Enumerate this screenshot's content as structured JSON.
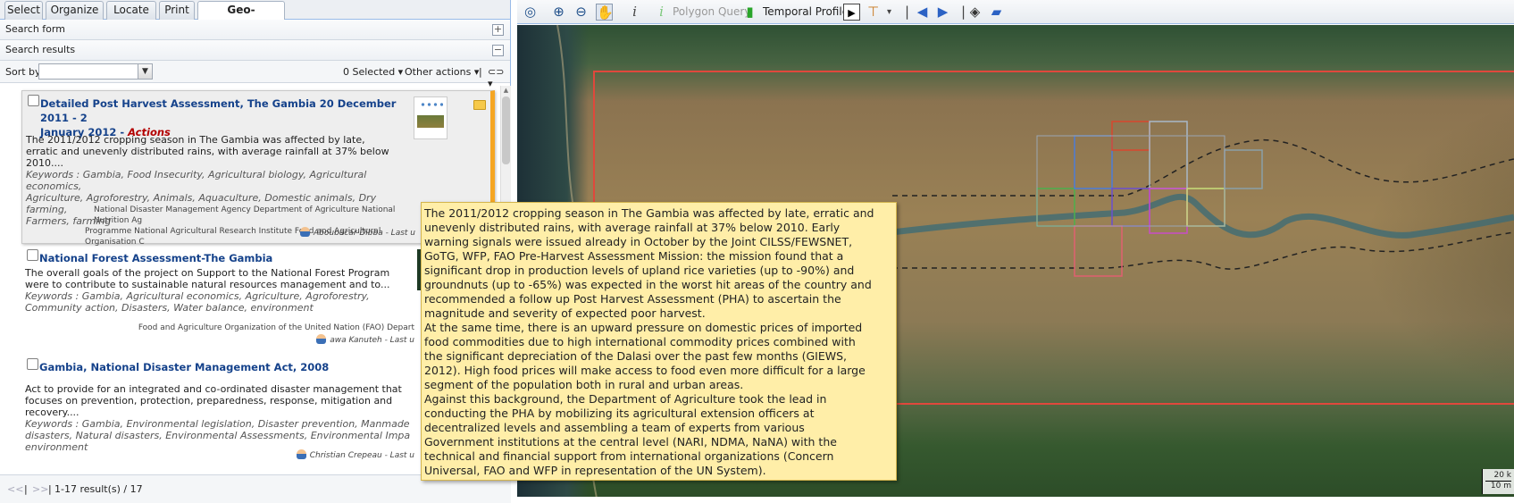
{
  "tabs": [
    "Select",
    "Organize",
    "Locate",
    "Print",
    "Geo-catalogue"
  ],
  "active_tab": "Geo-catalogue",
  "panels": {
    "search_form": "Search form",
    "search_form_toggle": "+",
    "search_results": "Search results",
    "search_results_toggle": "−"
  },
  "sortbar": {
    "sort_label": "Sort by",
    "sort_value": "",
    "selected": "0 Selected ▾",
    "other_actions": "Other actions ▾",
    "link_menu": "⊂⊃ ▾",
    "separator": "|"
  },
  "results": [
    {
      "title_line1": "Detailed Post Harvest Assessment, The Gambia 20 December 2011 - 2",
      "title_line2": "January 2012",
      "actions_label": "Actions",
      "abstract": [
        "The 2011/2012 cropping season in The Gambia was affected by late,",
        "erratic and unevenly distributed rains, with average rainfall at 37% below",
        "2010...."
      ],
      "keywords": [
        "Keywords : Gambia, Food Insecurity, Agricultural biology, Agricultural economics,",
        "Agriculture, Agroforestry, Animals, Aquaculture, Domestic animals, Dry farming,",
        "Farmers, farming"
      ],
      "orgs": [
        "National Disaster Management Agency   Department of Agriculture   National Nutrition Ag",
        "Programme   National Agricultural Research Institute   Food and Agricultural Organisation   C"
      ],
      "contact": "Aboubacar Dibba - Last u"
    },
    {
      "title_line1": "National Forest Assessment-The Gambia",
      "abstract": [
        "The overall goals of the project on Support to the National Forest Program",
        "were to contribute to sustainable natural resources management and to..."
      ],
      "keywords": [
        "Keywords : Gambia, Agricultural economics, Agriculture, Agroforestry,",
        "Community action, Disasters, Water balance, environment"
      ],
      "orgs": [
        "Food and Agriculture Organization of the United Nation (FAO)    Depart"
      ],
      "contact": "awa Kanuteh - Last u"
    },
    {
      "title_line1": "Gambia, National Disaster Management Act, 2008",
      "abstract": [
        "Act to provide for an integrated and co-ordinated disaster management that",
        "focuses on prevention, protection, preparedness, response, mitigation and recovery...."
      ],
      "keywords": [
        "Keywords : Gambia, Environmental legislation, Disaster prevention, Manmade",
        "disasters, Natural disasters, Environmental Assessments, Environmental Impa",
        "environment"
      ],
      "contact": "Christian Crepeau - Last u"
    }
  ],
  "pager": {
    "first": "<<",
    "sep1": "|",
    "next": ">>",
    "sep2": "|",
    "summary": "1-17 result(s) / 17"
  },
  "map_toolbar": {
    "polygon_query": "Polygon Query",
    "temporal_profiles": "Temporal Profiles"
  },
  "icons": [
    "zoom-extent-icon",
    "zoom-in-icon",
    "zoom-out-icon",
    "pan-hand-icon",
    "info-icon",
    "polygon-query-icon",
    "temporal-profiles-icon",
    "play-icon",
    "measure-icon",
    "nav-back-icon",
    "nav-forward-icon",
    "layers-icon",
    "folder-open-icon"
  ],
  "tooltip": {
    "lines": [
      "The 2011/2012 cropping season in The Gambia was affected by late, erratic and",
      "unevenly distributed rains, with average rainfall at 37% below 2010. Early",
      "warning signals were issued already in October by the Joint CILSS/FEWSNET,",
      "GoTG, WFP, FAO Pre-Harvest Assessment Mission: the mission found that a",
      "significant drop in production levels of upland rice varieties (up to -90%) and",
      "groundnuts (up to -65%) was expected in the worst hit areas of the country and",
      "recommended a follow up Post Harvest Assessment (PHA) to ascertain the",
      "magnitude and severity of expected poor harvest.",
      "At the same time, there is an upward pressure on domestic prices of imported",
      "food commodities due to high international commodity prices combined with",
      "the significant depreciation of the Dalasi over the past few months (GIEWS,",
      "2012). High food prices will make access to food even more difficult for a large",
      "segment of the population both in rural and urban areas.",
      "Against this background, the Department of Agriculture took the lead in",
      "conducting the PHA by mobilizing its agricultural extension officers at",
      "decentralized levels and assembling a team of experts from various",
      "Government institutions at the central level (NARI, NDMA, NaNA) with the",
      "technical and financial support from international organizations (Concern",
      "Universal, FAO and WFP in representation of the UN System)."
    ]
  },
  "scale": {
    "top": "20 k",
    "bottom": "10 m"
  },
  "colors": {
    "accent": "#15428b",
    "actions": "#b30000",
    "tooltip_bg": "#ffeea8",
    "bbox_red": "#e0483c",
    "selection_orange": "#f5a623"
  }
}
